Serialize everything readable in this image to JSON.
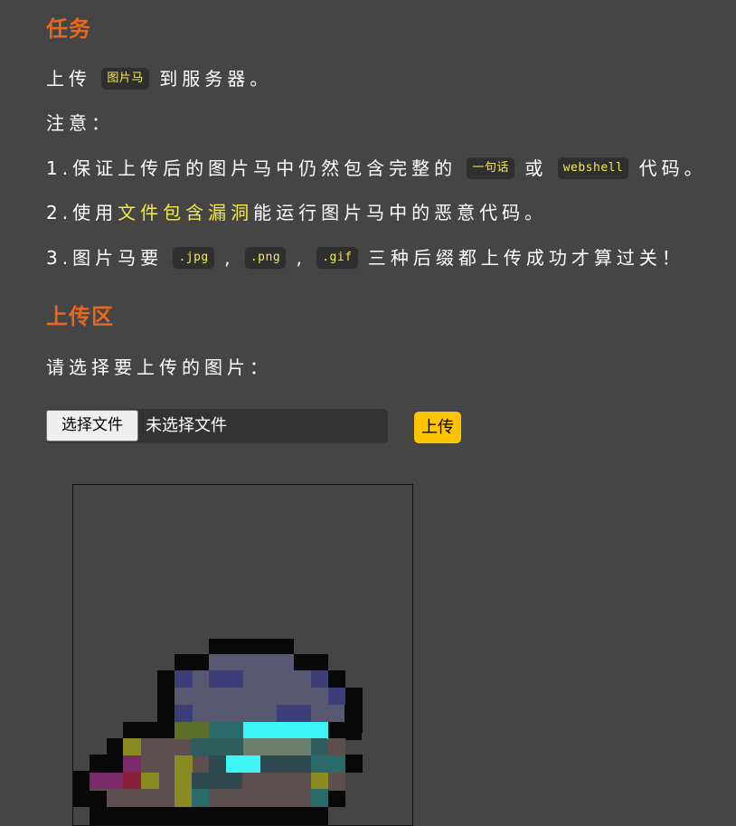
{
  "task_heading": "任务",
  "task": {
    "line1_pre": "上传",
    "line1_code": "图片马",
    "line1_post": "到服务器。",
    "note": "注意：",
    "item1_pre": "1.保证上传后的图片马中仍然包含完整的",
    "item1_code1": "一句话",
    "item1_mid": "或",
    "item1_code2": "webshell",
    "item1_post": "代码。",
    "item2_pre": "2.使用",
    "item2_highlight": "文件包含漏洞",
    "item2_post": "能运行图片马中的恶意代码。",
    "item3_pre": "3.图片马要",
    "item3_code1": ".jpg",
    "item3_sep1": ",",
    "item3_code2": ".png",
    "item3_sep2": ",",
    "item3_code3": ".gif",
    "item3_post": "三种后缀都上传成功才算过关！"
  },
  "upload_heading": "上传区",
  "upload": {
    "prompt": "请选择要上传的图片：",
    "choose_label": "选择文件",
    "no_file_text": "未选择文件",
    "submit_label": "上传"
  },
  "colors": {
    "background": "#454545",
    "heading": "#e8671e",
    "highlight": "#f2ea4f",
    "upload_button": "#ffc300"
  },
  "preview_icon": "pixel-art-slime-character"
}
